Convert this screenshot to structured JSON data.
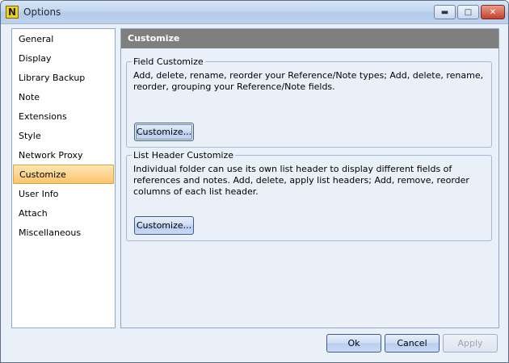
{
  "window": {
    "title": "Options",
    "app_icon_letter": "N"
  },
  "nav": {
    "items": [
      {
        "label": "General"
      },
      {
        "label": "Display"
      },
      {
        "label": "Library Backup"
      },
      {
        "label": "Note"
      },
      {
        "label": "Extensions"
      },
      {
        "label": "Style"
      },
      {
        "label": "Network Proxy"
      },
      {
        "label": "Customize",
        "selected": true
      },
      {
        "label": "User Info"
      },
      {
        "label": "Attach"
      },
      {
        "label": "Miscellaneous"
      }
    ]
  },
  "panel": {
    "header": "Customize",
    "field_customize": {
      "title": "Field Customize",
      "description": "Add, delete, rename, reorder your Reference/Note types; Add, delete, rename, reorder, grouping your Reference/Note fields.",
      "button_label": "Customize..."
    },
    "list_header_customize": {
      "title": "List Header Customize",
      "description": "Individual folder can use its own list header to display different fields of references and notes. Add, delete, apply list headers; Add, remove, reorder columns of each list header.",
      "button_label": "Customize..."
    }
  },
  "footer": {
    "ok_label": "Ok",
    "cancel_label": "Cancel",
    "apply_label": "Apply"
  },
  "colors": {
    "panel_header_bg": "#7f7f7f",
    "selected_item_bg": "#fbc46a",
    "close_button": "#c4412a"
  }
}
